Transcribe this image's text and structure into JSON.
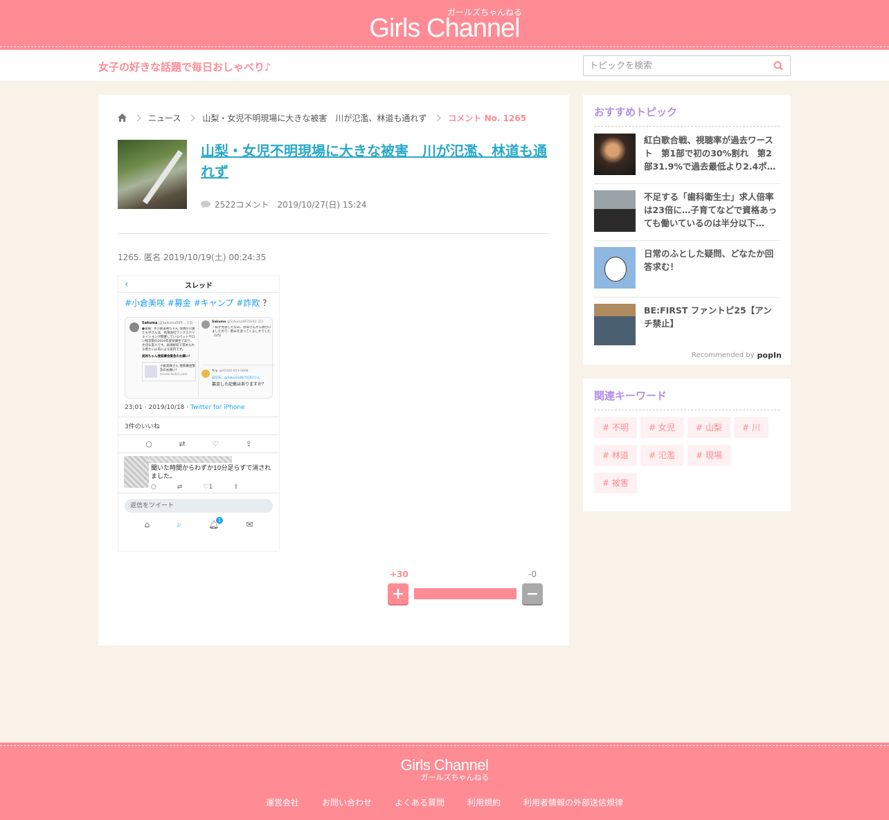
{
  "header": {
    "logo_text": "Girls Channel",
    "logo_kana": "ガールズちゃんねる",
    "tagline": "女子の好きな話題で毎日おしゃべり♪",
    "search_placeholder": "トピックを検索"
  },
  "breadcrumb": {
    "items": [
      "ニュース",
      "山梨・女児不明現場に大きな被害　川が氾濫、林道も通れず"
    ],
    "current": "コメント No. 1265"
  },
  "topic": {
    "title": "山梨・女児不明現場に大きな被害　川が氾濫、林道も通れず",
    "comment_count": "2522コメント",
    "date": "2019/10/27(日) 15:24"
  },
  "comment": {
    "header": "1265. 匿名 2019/10/19(土) 00:24:35",
    "vote_plus": "+30",
    "vote_minus": "-0",
    "plus_ratio": 1.0
  },
  "tweet_screenshot": {
    "nav_title": "スレッド",
    "hashtags": "#小倉美咲 #募金 #キャンプ #詐欺",
    "question_mark": "？",
    "embed_left_name": "Sakuma",
    "embed_left_handle": "@Sakuma895... 1日",
    "embed_left_text": "●速報：#小倉美咲ちゃん 母親の小倉とも子さんは、有限会社ワンクスクリエイションが開催しているペットサロン経営塾の2019年度受講生であり、大切な友人です。表現統収で求められる者たいよ氏による案内です。",
    "embed_left_link_title": "美咲ちゃん捜索募金緊急のお願い！",
    "embed_left_link_sub": "小倉美咲さん 捜索募金緊急のお願い！",
    "embed_left_link_url": "misaki-bokin.com",
    "embed_right_name": "Sakuma",
    "embed_right_handle": "@Sakuma8670282-331",
    "embed_right_text": "・私が見逃したなあ、お母さんから顔がいましたので、飲みを含ってくるしかでした（1/5）",
    "embed_right_reply_name": "ちゃ",
    "embed_right_reply_handle": "@05000-853-0808",
    "embed_right_reply_to": "返信先：@Sakuma8670282さん",
    "embed_right_reply_text": "募金した記拠はありますか？",
    "time": "23:01 · 2019/10/18 · ",
    "via": "Twitter for iPhone",
    "likes": "3件のいいね",
    "reply_text": "聞いた時間からわずか10分足らずで消されました。",
    "reply_box": "返信をツイート",
    "reply_like_count": "1",
    "notif_badge": "1"
  },
  "sidebar": {
    "rec_heading": "おすすめトピック",
    "recommendations": [
      {
        "title": "紅白歌合戦、視聴率が過去ワースト　第1部で初の30%割れ　第2部31.9%で過去最低より2.4ポ…"
      },
      {
        "title": "不足する「歯科衛生士」求人倍率は23倍に…子育てなどで資格あっても働いているのは半分以下…"
      },
      {
        "title": "日常のふとした疑問、どなたか回答求む！"
      },
      {
        "title": "BE:FIRST ファントピ25【アンチ禁止】"
      }
    ],
    "popin_label": "Recommended by",
    "popin_brand": "popIn",
    "kw_heading": "関連キーワード",
    "keywords": [
      "# 不明",
      "# 女児",
      "# 山梨",
      "# 川",
      "# 林道",
      "# 氾濫",
      "# 現場",
      "# 被害"
    ]
  },
  "footer": {
    "logo_text": "Girls Channel",
    "logo_kana": "ガールズちゃんねる",
    "links": [
      "運営会社",
      "お問い合わせ",
      "よくある質問",
      "利用規約",
      "利用者情報の外部送信規律"
    ]
  },
  "colors": {
    "brand": "#ff8b95",
    "link": "#29a8c7",
    "heading_purple": "#b48ee6",
    "background": "#f9f2e8"
  }
}
